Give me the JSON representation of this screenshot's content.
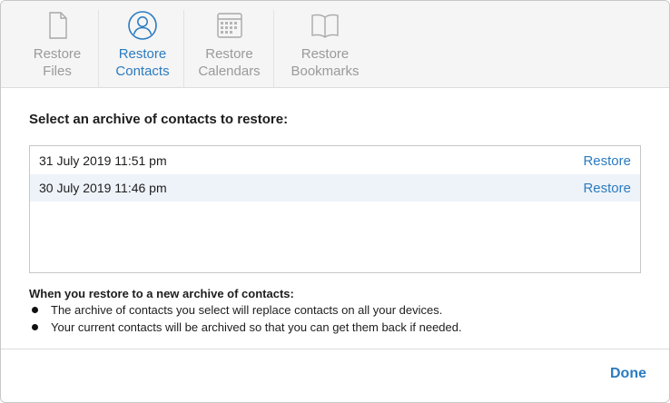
{
  "tabs": [
    {
      "line1": "Restore",
      "line2": "Files",
      "icon": "document-icon",
      "active": false
    },
    {
      "line1": "Restore",
      "line2": "Contacts",
      "icon": "contacts-icon",
      "active": true
    },
    {
      "line1": "Restore",
      "line2": "Calendars",
      "icon": "calendar-icon",
      "active": false
    },
    {
      "line1": "Restore",
      "line2": "Bookmarks",
      "icon": "book-icon",
      "active": false
    }
  ],
  "heading": "Select an archive of contacts to restore:",
  "archives": [
    {
      "date": "31 July 2019 11:51 pm",
      "action": "Restore"
    },
    {
      "date": "30 July 2019 11:46 pm",
      "action": "Restore"
    }
  ],
  "note": {
    "title": "When you restore to a new archive of contacts:",
    "bullets": [
      "The archive of contacts you select will replace contacts on all your devices.",
      "Your current contacts will be archived so that you can get them back if needed."
    ]
  },
  "footer": {
    "done_label": "Done"
  },
  "colors": {
    "accent": "#2b7bc0",
    "inactive_tab": "#9a9a9a",
    "selected_row": "#eef3f9"
  }
}
